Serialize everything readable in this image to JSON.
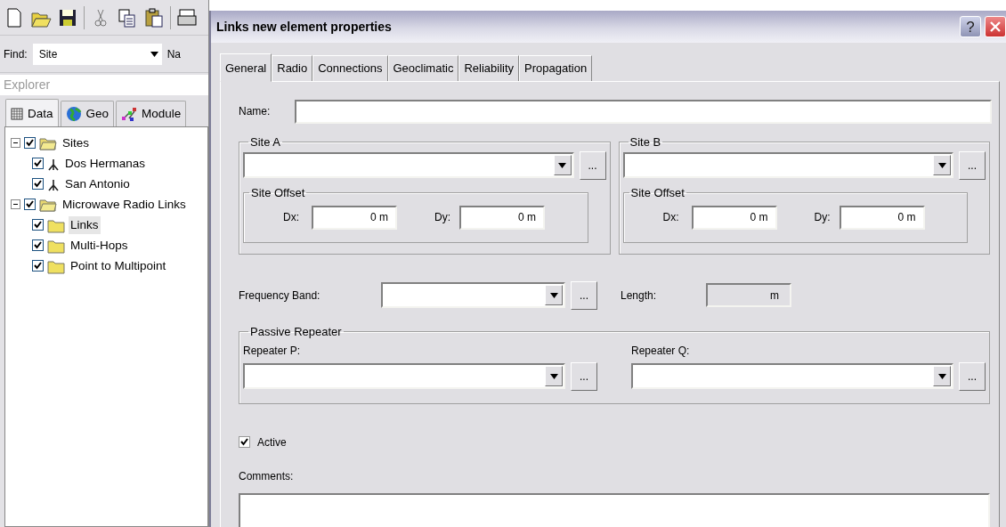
{
  "toolbar": [
    {
      "kind": "new"
    },
    {
      "kind": "open"
    },
    {
      "kind": "save"
    },
    {
      "kind": "separator"
    },
    {
      "kind": "cut"
    },
    {
      "kind": "copy"
    },
    {
      "kind": "paste"
    },
    {
      "kind": "separator"
    },
    {
      "kind": "print"
    }
  ],
  "find": {
    "label": "Find:",
    "value": "Site",
    "next_label": "Na"
  },
  "explorer": {
    "title": "Explorer",
    "tabs": [
      {
        "label": "Data",
        "kind": "grid",
        "selected": true
      },
      {
        "label": "Geo",
        "kind": "globe",
        "selected": false
      },
      {
        "label": "Module",
        "kind": "modules",
        "selected": false
      }
    ],
    "tree": [
      {
        "label": "Sites",
        "kind": "group",
        "checked": true,
        "expanded": true,
        "selected": false,
        "children": [
          {
            "label": "Dos Hermanas",
            "kind": "site",
            "checked": true,
            "selected": false
          },
          {
            "label": "San Antonio",
            "kind": "site",
            "checked": true,
            "selected": false
          }
        ]
      },
      {
        "label": "Microwave Radio Links",
        "kind": "group",
        "checked": true,
        "expanded": true,
        "selected": false,
        "children": [
          {
            "label": "Links",
            "kind": "folder",
            "checked": true,
            "selected": true
          },
          {
            "label": "Multi-Hops",
            "kind": "folder",
            "checked": true,
            "selected": false
          },
          {
            "label": "Point to Multipoint",
            "kind": "folder",
            "checked": true,
            "selected": false
          }
        ]
      }
    ]
  },
  "dialog": {
    "title": "Links new element properties",
    "help_button": "?",
    "tabs": [
      {
        "label": "General",
        "selected": true
      },
      {
        "label": "Radio",
        "selected": false
      },
      {
        "label": "Connections",
        "selected": false
      },
      {
        "label": "Geoclimatic",
        "selected": false
      },
      {
        "label": "Reliability",
        "selected": false
      },
      {
        "label": "Propagation",
        "selected": false
      }
    ],
    "name_label": "Name:",
    "sites": [
      {
        "title": "Site A",
        "browse": "...",
        "offset_title": "Site Offset",
        "dx_label": "Dx:",
        "dx": "0 m",
        "dy_label": "Dy:",
        "dy": "0 m"
      },
      {
        "title": "Site B",
        "browse": "...",
        "offset_title": "Site Offset",
        "dx_label": "Dx:",
        "dx": "0 m",
        "dy_label": "Dy:",
        "dy": "0 m"
      }
    ],
    "frequency_label": "Frequency Band:",
    "frequency_browse": "...",
    "length_label": "Length:",
    "length": "m",
    "passive_repeater": {
      "title": "Passive Repeater",
      "repeaters": [
        {
          "label": "Repeater P:",
          "browse": "..."
        },
        {
          "label": "Repeater Q:",
          "browse": "..."
        }
      ]
    },
    "active": {
      "label": "Active",
      "checked": true
    },
    "comments_label": "Comments:"
  }
}
